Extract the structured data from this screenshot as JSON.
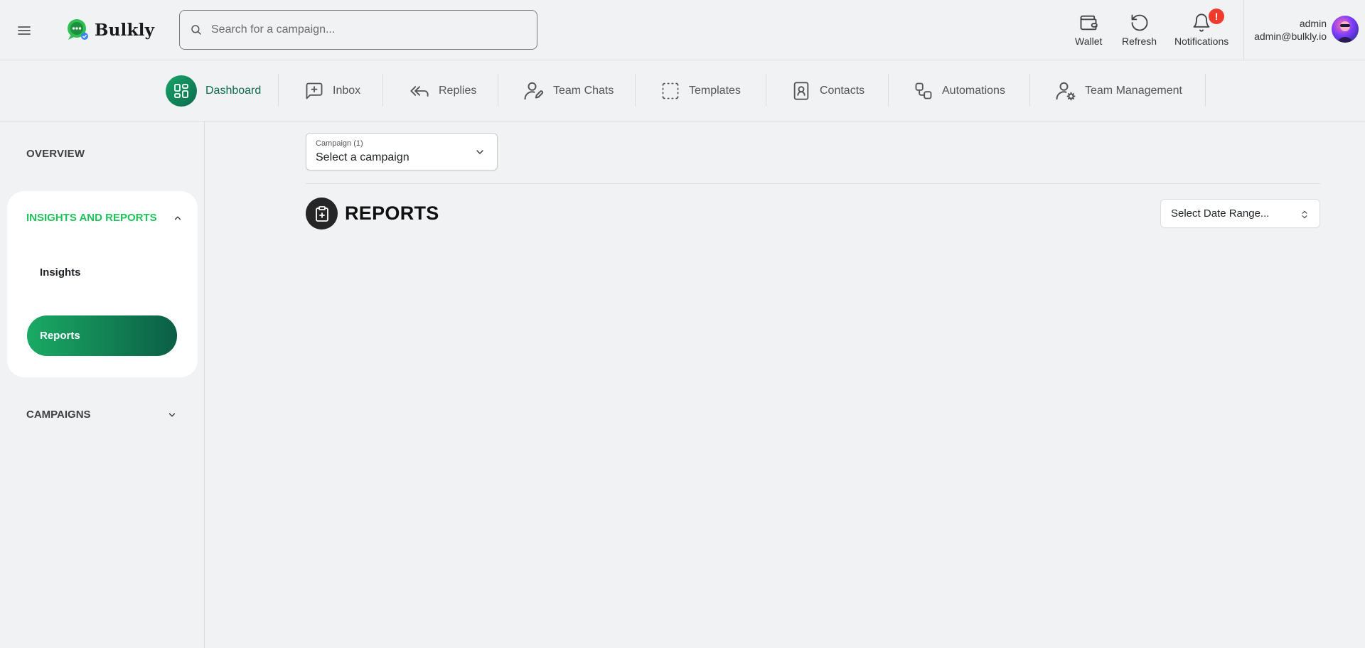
{
  "header": {
    "logo_text": "Bulkly",
    "search_placeholder": "Search for a campaign...",
    "wallet_label": "Wallet",
    "refresh_label": "Refresh",
    "notifications_label": "Notifications",
    "notifications_badge": "!",
    "user_name": "admin",
    "user_email": "admin@bulkly.io"
  },
  "nav": {
    "items": [
      {
        "label": "Dashboard",
        "icon": "dashboard-grid-icon",
        "active": true
      },
      {
        "label": "Inbox",
        "icon": "inbox-plus-icon"
      },
      {
        "label": "Replies",
        "icon": "reply-all-icon"
      },
      {
        "label": "Team Chats",
        "icon": "user-pen-icon"
      },
      {
        "label": "Templates",
        "icon": "dashed-square-icon"
      },
      {
        "label": "Contacts",
        "icon": "contact-book-icon"
      },
      {
        "label": "Automations",
        "icon": "workflow-icon"
      },
      {
        "label": "Team Management",
        "icon": "user-gear-icon"
      }
    ]
  },
  "sidebar": {
    "overview": "OVERVIEW",
    "group_title": "INSIGHTS AND REPORTS",
    "insights": "Insights",
    "reports": "Reports",
    "campaigns": "CAMPAIGNS"
  },
  "main": {
    "campaign_label": "Campaign (1)",
    "campaign_value": "Select a campaign",
    "title": "REPORTS",
    "date_range": "Select Date Range..."
  },
  "colors": {
    "accent_green": "#20c35a",
    "brand_dark_green": "#0b6b4c",
    "badge_red": "#ef3b2d"
  }
}
